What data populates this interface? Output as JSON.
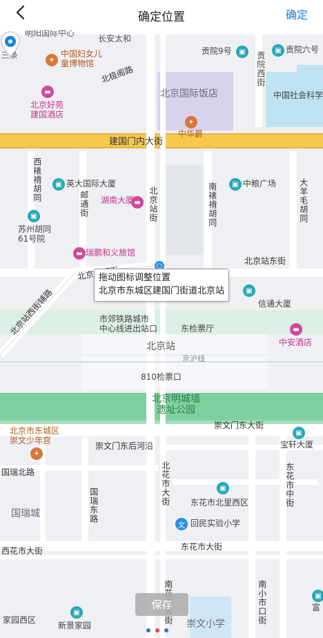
{
  "header": {
    "title": "确定位置",
    "confirm_label": "确定"
  },
  "tooltip": {
    "line1": "拖动图标调整位置",
    "line2": "北京市东城区建国门街道北京站"
  },
  "save_label": "保存",
  "labels": {
    "mingzhao": "明阳国际中心",
    "changan": "长安太和",
    "santiao": "三条",
    "women": "中国妇女儿\n童博物馆",
    "gongyuan9": "贡院9号",
    "gongyuan6": "贡院六号",
    "gongyuan_west": "贡院西街",
    "beijige": "北极阁路",
    "intl_hotel": "北京国际饭店",
    "social_science": "中国社会科学",
    "haoyuan": "北京好苑\n建国酒店",
    "zhonghuajue": "中华爵",
    "jianguomennei": "建国门内大街",
    "xiti": "西裱褙胡同",
    "yingda": "英大国际大厦",
    "youtong": "邮通街",
    "hunan": "湖南大厦",
    "beijingzhanjie": "北京站街",
    "nanti": "南裱褙胡同",
    "zhongliang": "中粮广场",
    "dayangmao": "大羊毛胡同",
    "suzhou": "苏州胡同\n61号院",
    "ruipeng": "瑞鹏和义旅馆",
    "bjzxj": "北京站西街",
    "bjz_xijie_left": "北京站西街辅路",
    "bjzdj": "北京站东街",
    "xintong": "信通大厦",
    "jiaoqu": "市郊铁路城市\n中心线进出站口",
    "dongjian": "东检票厅",
    "station": "北京站",
    "jinghu": "京沪线",
    "gate810": "810检票口",
    "zhongan": "中安酒店",
    "mingwall": "北京明城墙\n遗址公园",
    "dongcheng_youth": "北京市东城区\n崇文少年宫",
    "chongwenmendong": "崇文门东大街",
    "chongwenmen_houhe": "崇文门东后河沿",
    "baoxuan": "宝轩大厦",
    "guorui_north": "国瑞北路",
    "guoruicheng": "国瑞城",
    "guorui_east": "国瑞东路",
    "dhs_west": "北花市大街",
    "dhs_north_west": "东花市北里西区",
    "dhs_middle": "东花市中街",
    "huimin": "回民实验小学",
    "xhs": "西花市大街",
    "dhs_main": "东花市大街",
    "nanhuashi": "南花市大街",
    "nanxiaoshikou": "南小市口街",
    "jiayuan": "家园西区",
    "xinjing": "新景家园",
    "chongwen_school": "崇文小学",
    "fu": "富"
  },
  "icons": {
    "back": "chevron-left-icon",
    "pin": "location-pin-icon"
  },
  "colors": {
    "accent": "#1b7fe0",
    "map_bg": "#eef0f3",
    "road_main": "#f5c94d",
    "park": "#7fd0a0",
    "water": "#bfe3f2"
  }
}
